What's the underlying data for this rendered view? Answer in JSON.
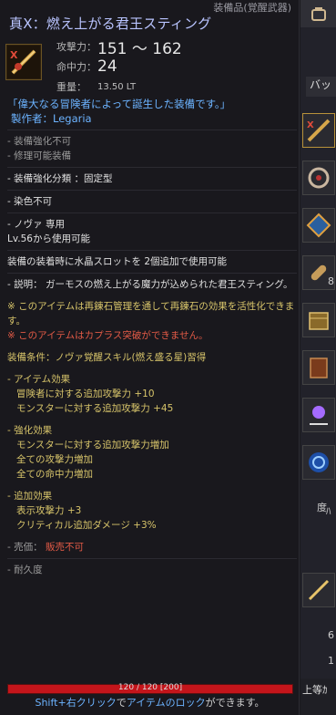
{
  "tooltip": {
    "category": "装備品(覚醒武器)",
    "title": "真X：燃え上がる君王スティング",
    "stats": {
      "attack_label": "攻撃力：",
      "attack_value": "151 ～ 162",
      "accuracy_label": "命中力：",
      "accuracy_value": "24",
      "weight_label": "重量：",
      "weight_value": "13.50 LT"
    },
    "quote": "「偉大なる冒険者によって誕生した装備です。」",
    "maker": "製作者：Legaria",
    "lines": {
      "no_enhance": "- 装備強化不可",
      "repairable": "- 修理可能装備",
      "enhance_class": "- 装備強化分類 ：固定型",
      "no_dye": "- 染色不可",
      "class_only": "- ノヴァ 専用",
      "level_req": "Lv.56から使用可能",
      "crystal_slot": "装備の装着時に水晶スロットを 2個追加で使用可能",
      "description": "- 説明： ガーモスの燃え上がる魔力が込められた君王スティング。",
      "refine_note": "※ このアイテムは再錬石管理を通して再錬石の効果を活性化できます。",
      "no_kapras": "※ このアイテムはカプラス突破ができません。",
      "equip_condition": "装備条件：ノヴァ覚醒スキル(燃え盛る星)習得",
      "item_effect_title": "- アイテム効果",
      "item_effect_1": "冒険者に対する追加攻撃力 +10",
      "item_effect_2": "モンスターに対する追加攻撃力 +45",
      "enh_effect_title": "- 強化効果",
      "enh_effect_1": "モンスターに対する追加攻撃力増加",
      "enh_effect_2": "全ての攻撃力増加",
      "enh_effect_3": "全ての命中力増加",
      "add_effect_title": "- 追加効果",
      "add_effect_1": "表示攻撃力 +3",
      "add_effect_2": "クリティカル追加ダメージ +3%",
      "price_label": "- 売価：",
      "price_value": "販売不可",
      "durability_label": "- 耐久度"
    },
    "durability": {
      "text": "120 / 120 [200]",
      "current": 120,
      "max": 120
    },
    "hint": {
      "key": "Shift+右クリック",
      "middle": "で",
      "highlight": "アイテムのロック",
      "end": "ができます。"
    }
  },
  "inventory_strip": {
    "tab_label": "バッ",
    "slot_count_label": "8",
    "misc_1": "ﾊ",
    "misc_2": "6",
    "misc_3": "1",
    "bottom_label": "上等ｶ",
    "degree_label": "度"
  },
  "colors": {
    "title": "#b9c4ff",
    "blue": "#6cb3ff",
    "gold": "#d7c46a",
    "red": "#e25a46",
    "durability": "#c4151b"
  }
}
